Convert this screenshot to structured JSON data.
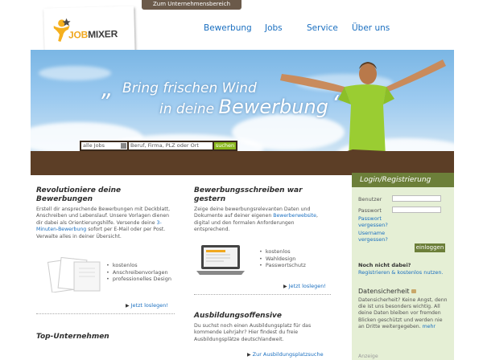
{
  "top_tab": "Zum Unternehmensbereich",
  "logo": {
    "job": "JOB",
    "mixer": "MIXER"
  },
  "nav": {
    "bewerbung": "Bewerbung",
    "jobs": "Jobs",
    "service": "Service",
    "ueber": "Über uns"
  },
  "hero": {
    "line1": "Bring frischen Wind",
    "line2a": "in deine ",
    "line2b": "Bewerbung",
    "open_quote": "„",
    "close_quote": "“"
  },
  "search": {
    "select_value": "alle Jobs",
    "placeholder": "Beruf, Firma, PLZ oder Ort",
    "button": "suchen"
  },
  "col1": {
    "title": "Revolutioniere deine Bewerbungen",
    "text": "Erstell dir ansprechende Bewerbungen mit Deckblatt, Anschreiben und Lebenslauf. Unsere Vorlagen dienen dir dabei als Orientierungshilfe. Versende deine ",
    "link": "3-Minuten-Bewerbung",
    "text2": " sofort per E-Mail oder per Post. Verwalte alles in deiner Übersicht.",
    "bullets": [
      "kostenlos",
      "Anschreibenvorlagen",
      "professionelles Design"
    ],
    "more": "Jetzt loslegen!",
    "title2": "Top-Unternehmen"
  },
  "col2": {
    "title": "Bewerbungsschreiben war gestern",
    "text": "Zeige deine bewerbungsrelevanten Daten und Dokumente auf deiner eigenen ",
    "link": "Bewerberwebsite",
    "text2": ", digital und den formalen Anforderungen entsprechend.",
    "bullets": [
      "kostenlos",
      "Wahldesign",
      "Passwortschutz"
    ],
    "more": "Jetzt loslegen!",
    "title2": "Ausbildungsoffensive",
    "text3": "Du suchst noch einen Ausbildungsplatz für das kommende Lehrjahr? Hier findest du freie Ausbildungsplätze deutschlandweit.",
    "more2": "Zur Ausbildungsplatzsuche"
  },
  "sidebar": {
    "title": "Login/Registrierung",
    "user_label": "Benutzer",
    "pass_label": "Passwort",
    "forgot_pass": "Passwort vergessen?",
    "forgot_user": "Username vergessen?",
    "login": "einloggen",
    "not_member": "Noch nicht dabei?",
    "register": "Registrieren & kostenlos nutzen.",
    "security_title": "Datensicherheit",
    "security_text1": "Datensicherheit? Keine Angst, denn die ist uns besonders wichtig. All deine Daten bleiben vor fremden Blicken geschützt und werden nie an Dritte weitergegeben. ",
    "security_more": "mehr",
    "cut_label": "Anzeige"
  },
  "colors": {
    "link": "#1a6fc0",
    "brown": "#5c3e26",
    "green": "#6c7f39",
    "sidebar_bg": "#e5efd5"
  }
}
